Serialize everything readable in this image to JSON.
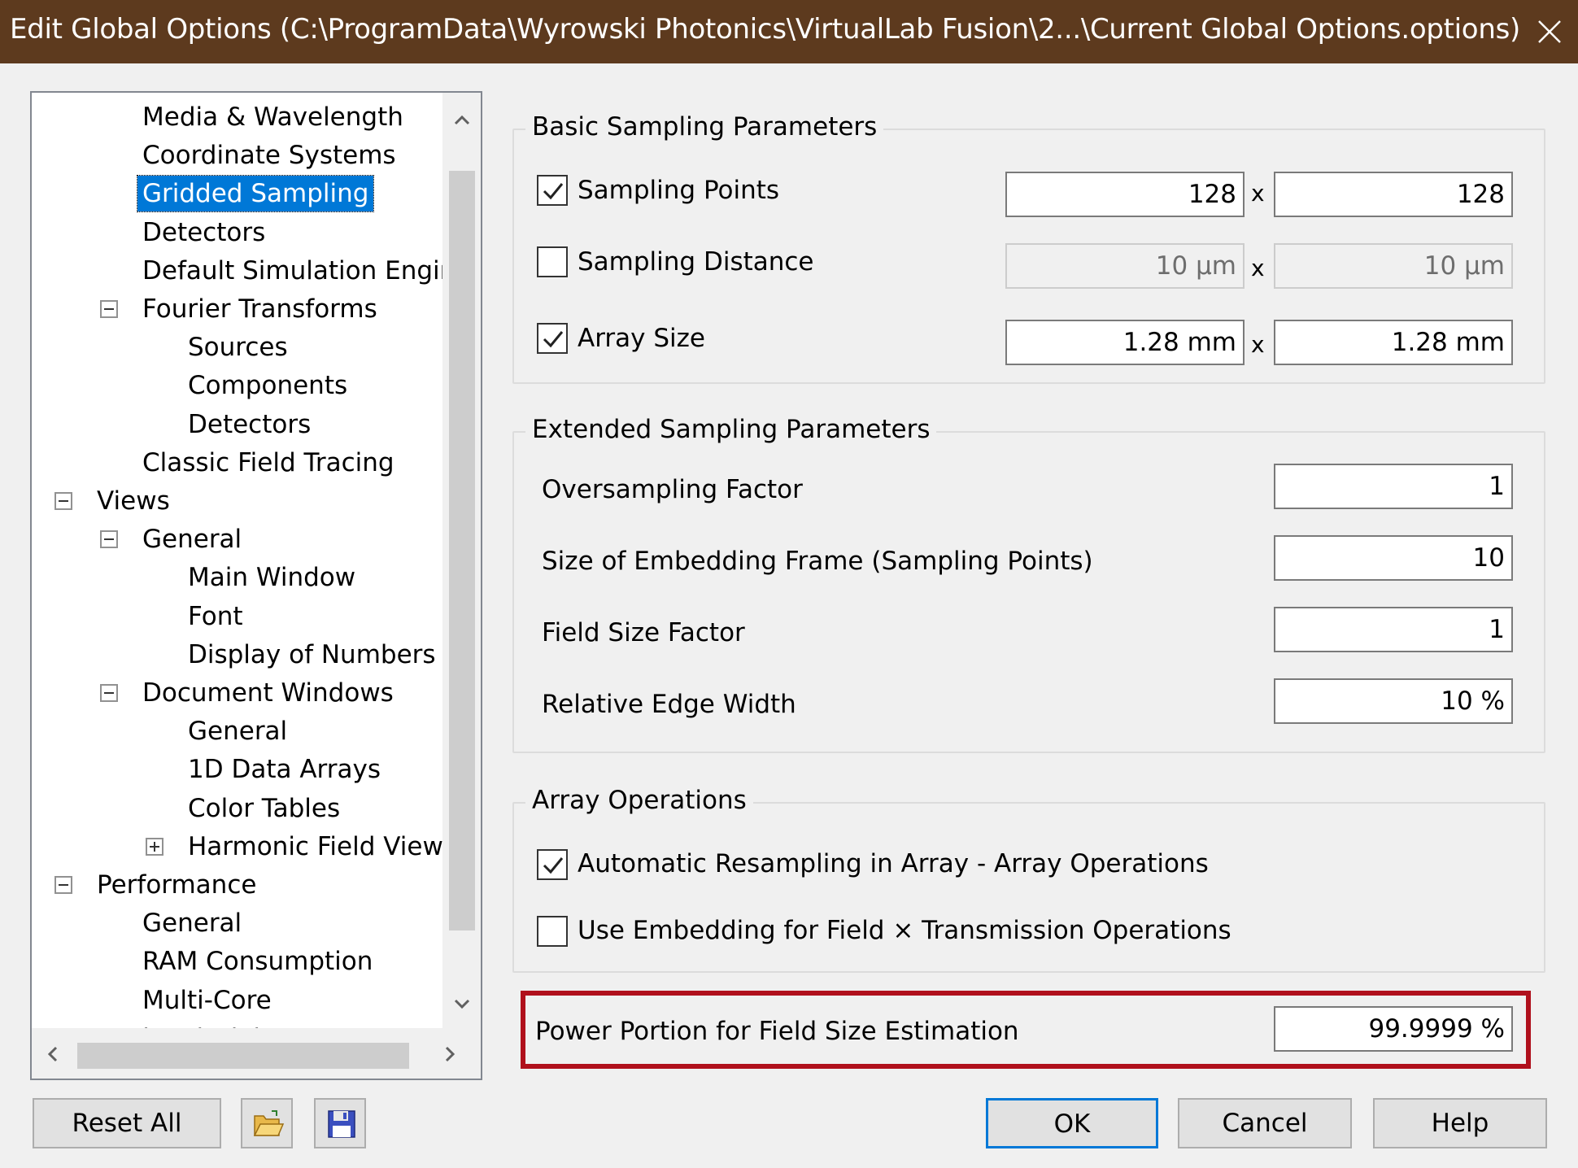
{
  "window": {
    "title": "Edit Global Options (C:\\ProgramData\\Wyrowski Photonics\\VirtualLab Fusion\\2...\\Current Global Options.options)"
  },
  "tree": {
    "items": [
      {
        "label": "Media & Wavelength",
        "level": 2,
        "expander": "none"
      },
      {
        "label": "Coordinate Systems",
        "level": 2,
        "expander": "none"
      },
      {
        "label": "Gridded Sampling",
        "level": 2,
        "expander": "none",
        "selected": true
      },
      {
        "label": "Detectors",
        "level": 2,
        "expander": "none"
      },
      {
        "label": "Default Simulation Engir",
        "level": 2,
        "expander": "none"
      },
      {
        "label": "Fourier Transforms",
        "level": 2,
        "expander": "minus"
      },
      {
        "label": "Sources",
        "level": 3,
        "expander": "none"
      },
      {
        "label": "Components",
        "level": 3,
        "expander": "none"
      },
      {
        "label": "Detectors",
        "level": 3,
        "expander": "none"
      },
      {
        "label": "Classic Field Tracing",
        "level": 2,
        "expander": "none"
      },
      {
        "label": "Views",
        "level": 1,
        "expander": "minus"
      },
      {
        "label": "General",
        "level": 2,
        "expander": "minus"
      },
      {
        "label": "Main Window",
        "level": 3,
        "expander": "none"
      },
      {
        "label": "Font",
        "level": 3,
        "expander": "none"
      },
      {
        "label": "Display of Numbers",
        "level": 3,
        "expander": "none"
      },
      {
        "label": "Document Windows",
        "level": 2,
        "expander": "minus"
      },
      {
        "label": "General",
        "level": 3,
        "expander": "none"
      },
      {
        "label": "1D Data Arrays",
        "level": 3,
        "expander": "none"
      },
      {
        "label": "Color Tables",
        "level": 3,
        "expander": "none"
      },
      {
        "label": "Harmonic Field View",
        "level": 3,
        "expander": "plus"
      },
      {
        "label": "Performance",
        "level": 1,
        "expander": "minus"
      },
      {
        "label": "General",
        "level": 2,
        "expander": "none"
      },
      {
        "label": "RAM Consumption",
        "level": 2,
        "expander": "none"
      },
      {
        "label": "Multi-Core",
        "level": 2,
        "expander": "none"
      },
      {
        "label": "Optional Dialogs",
        "level": 1,
        "expander": "minus"
      }
    ]
  },
  "basic": {
    "title": "Basic Sampling Parameters",
    "sampling_points": {
      "label": "Sampling Points",
      "checked": true,
      "x": "128",
      "y": "128"
    },
    "sampling_distance": {
      "label": "Sampling Distance",
      "checked": false,
      "x": "10 µm",
      "y": "10 µm"
    },
    "array_size": {
      "label": "Array Size",
      "checked": true,
      "x": "1.28 mm",
      "y": "1.28 mm"
    },
    "times": "x"
  },
  "extended": {
    "title": "Extended Sampling Parameters",
    "oversampling": {
      "label": "Oversampling Factor",
      "value": "1"
    },
    "embedding": {
      "label": "Size of Embedding Frame (Sampling Points)",
      "value": "10"
    },
    "field_size": {
      "label": "Field Size Factor",
      "value": "1"
    },
    "edge_width": {
      "label": "Relative Edge Width",
      "value": "10 %"
    }
  },
  "array_ops": {
    "title": "Array Operations",
    "auto_resample": {
      "label": "Automatic Resampling in Array - Array Operations",
      "checked": true
    },
    "use_embedding": {
      "label": "Use Embedding for Field × Transmission Operations",
      "checked": false
    }
  },
  "power_portion": {
    "label": "Power Portion for Field Size Estimation",
    "value": "99.9999 %"
  },
  "buttons": {
    "reset_all": "Reset All",
    "ok": "OK",
    "cancel": "Cancel",
    "help": "Help"
  },
  "colors": {
    "titlebar": "#5d3a1e",
    "selection": "#0078d7",
    "highlight": "#b0101c"
  }
}
